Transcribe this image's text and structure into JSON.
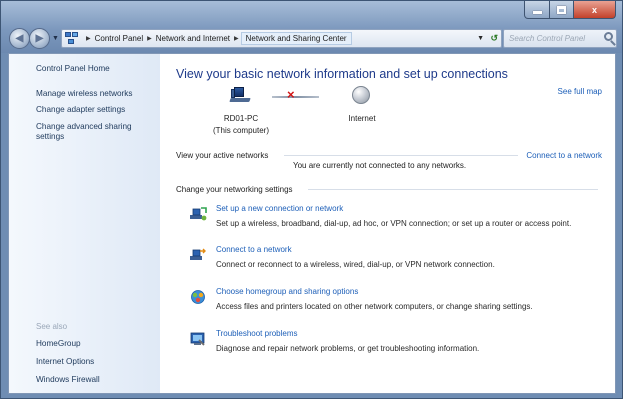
{
  "window": {
    "caption_close_glyph": "x"
  },
  "nav": {
    "back_icon": "arrow-left-icon",
    "forward_icon": "arrow-right-icon",
    "breadcrumbs": [
      "Control Panel",
      "Network and Internet",
      "Network and Sharing Center"
    ],
    "refresh_icon": "refresh-icon",
    "search_placeholder": "Search Control Panel"
  },
  "sidebar": {
    "home": "Control Panel Home",
    "links": [
      "Manage wireless networks",
      "Change adapter settings",
      "Change advanced sharing settings"
    ],
    "see_also_heading": "See also",
    "see_also": [
      "HomeGroup",
      "Internet Options",
      "Windows Firewall"
    ]
  },
  "main": {
    "heading": "View your basic network information and set up connections",
    "see_full_map": "See full map",
    "map": {
      "computer_name": "RD01-PC",
      "computer_sub": "(This computer)",
      "internet_label": "Internet",
      "status_glyph": "×"
    },
    "active_networks": {
      "label": "View your active networks",
      "status": "You are currently not connected to any networks.",
      "connect_link": "Connect to a network"
    },
    "settings_label": "Change your networking settings",
    "tasks": [
      {
        "link": "Set up a new connection or network",
        "desc": "Set up a wireless, broadband, dial-up, ad hoc, or VPN connection; or set up a router or access point."
      },
      {
        "link": "Connect to a network",
        "desc": "Connect or reconnect to a wireless, wired, dial-up, or VPN network connection."
      },
      {
        "link": "Choose homegroup and sharing options",
        "desc": "Access files and printers located on other network computers, or change sharing settings."
      },
      {
        "link": "Troubleshoot problems",
        "desc": "Diagnose and repair network problems, or get troubleshooting information."
      }
    ]
  },
  "colors": {
    "link": "#1d5fb8",
    "heading": "#1e3a8a",
    "error_x": "#d11414",
    "window_frame": "#6f8db3"
  }
}
